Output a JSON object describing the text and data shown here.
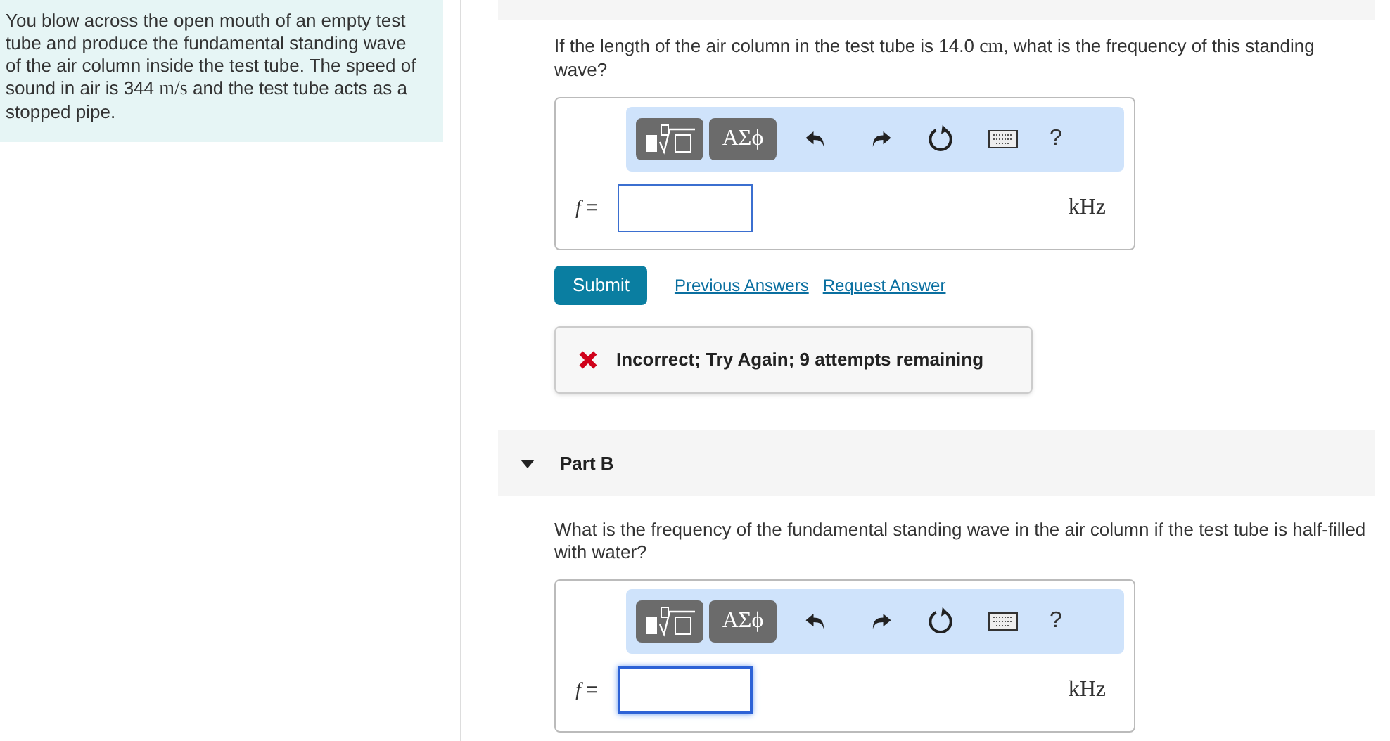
{
  "problem": {
    "parts": [
      {
        "kind": "text",
        "text": "You blow across the open mouth of an empty test tube and produce the fundamental standing wave of the air column inside the test tube. The speed of sound in air is 344 "
      },
      {
        "kind": "math",
        "text": "m/s"
      },
      {
        "kind": "text",
        "text": " and the test tube acts as a stopped pipe."
      }
    ]
  },
  "part_a": {
    "question": [
      {
        "kind": "text",
        "text": "If the length of the air column in the test tube is 14.0 "
      },
      {
        "kind": "math",
        "text": "cm"
      },
      {
        "kind": "text",
        "text": ", what is the frequency of this standing wave?"
      }
    ],
    "toolbar": {
      "symbols_label": "ΑΣϕ",
      "help_label": "?"
    },
    "answer": {
      "variable": "f",
      "equals": "=",
      "unit": "kHz",
      "focused": false
    },
    "submit": "Submit",
    "links": [
      "Previous Answers",
      "Request Answer"
    ],
    "feedback": {
      "kind": "incorrect",
      "message": "Incorrect; Try Again; 9 attempts remaining"
    }
  },
  "part_b": {
    "title": "Part B",
    "expanded": true,
    "question": [
      {
        "kind": "text",
        "text": "What is the frequency of the fundamental standing wave in the air column if the test tube is half-filled with water?"
      }
    ],
    "toolbar": {
      "symbols_label": "ΑΣϕ",
      "help_label": "?"
    },
    "answer": {
      "variable": "f",
      "equals": "=",
      "unit": "kHz",
      "focused": true
    }
  }
}
